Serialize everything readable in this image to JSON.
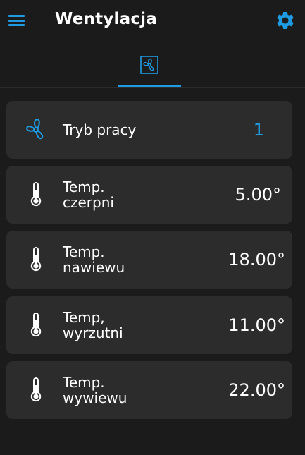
{
  "header": {
    "title": "Wentylacja",
    "menu_icon": "hamburger-menu-icon",
    "settings_icon": "gear-icon"
  },
  "tabs": [
    {
      "icon": "fan-icon",
      "active": true
    }
  ],
  "colors": {
    "accent": "#1f9be3",
    "background": "#1b1b1b",
    "card": "#2c2c2c",
    "text": "#ffffff"
  },
  "items": [
    {
      "icon": "fan-icon",
      "label_line1": "Tryb pracy",
      "label_line2": "",
      "value": "1"
    },
    {
      "icon": "thermometer-icon",
      "label_line1": "Temp.",
      "label_line2": "czerpni",
      "value": "5.00°"
    },
    {
      "icon": "thermometer-icon",
      "label_line1": "Temp.",
      "label_line2": "nawiewu",
      "value": "18.00°"
    },
    {
      "icon": "thermometer-icon",
      "label_line1": "Temp,",
      "label_line2": "wyrzutni",
      "value": "11.00°"
    },
    {
      "icon": "thermometer-icon",
      "label_line1": "Temp.",
      "label_line2": "wywiewu",
      "value": "22.00°"
    }
  ]
}
